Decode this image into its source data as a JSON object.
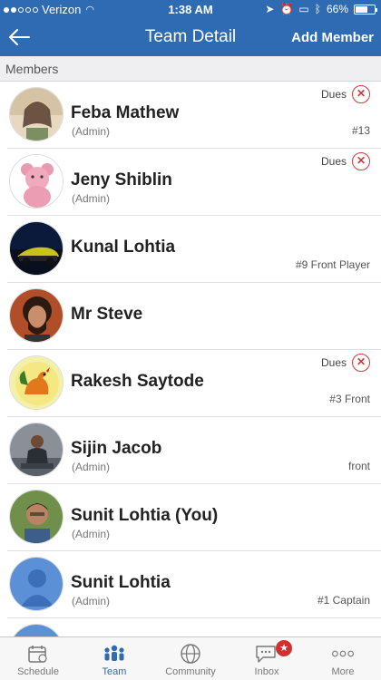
{
  "status_bar": {
    "carrier": "Verizon",
    "time": "1:38 AM",
    "battery": "66%",
    "battery_level": 0.66
  },
  "nav": {
    "title": "Team Detail",
    "add_member_label": "Add Member",
    "back_icon": "arrow-left-icon"
  },
  "section": {
    "title": "Members"
  },
  "members": [
    {
      "name": "Feba Mathew",
      "role": "(Admin)",
      "dues": "Dues",
      "info": "#13"
    },
    {
      "name": "Jeny Shiblin",
      "role": "(Admin)",
      "dues": "Dues",
      "info": ""
    },
    {
      "name": "Kunal Lohtia",
      "role": "",
      "dues": "",
      "info": "#9  Front Player"
    },
    {
      "name": "Mr Steve",
      "role": "",
      "dues": "",
      "info": ""
    },
    {
      "name": "Rakesh Saytode",
      "role": "",
      "dues": "Dues",
      "info": "#3  Front"
    },
    {
      "name": "Sijin Jacob",
      "role": "(Admin)",
      "dues": "",
      "info": "front"
    },
    {
      "name": "Sunit Lohtia (You)",
      "role": "(Admin)",
      "dues": "",
      "info": ""
    },
    {
      "name": "Sunit Lohtia",
      "role": "(Admin)",
      "dues": "",
      "info": "#1  Captain"
    }
  ],
  "tabs": [
    {
      "label": "Schedule",
      "icon": "calendar-icon"
    },
    {
      "label": "Team",
      "icon": "team-icon",
      "active": true
    },
    {
      "label": "Community",
      "icon": "globe-icon"
    },
    {
      "label": "Inbox",
      "icon": "chat-icon",
      "badge": "★"
    },
    {
      "label": "More",
      "icon": "more-icon"
    }
  ],
  "colors": {
    "brand": "#2e6bb3",
    "dues_x": "#d23a3a"
  }
}
